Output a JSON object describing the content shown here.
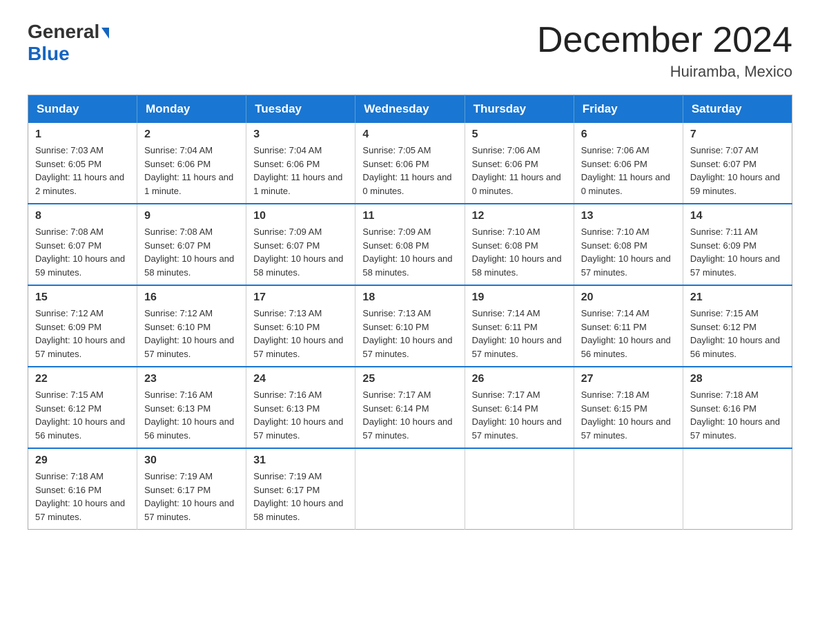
{
  "header": {
    "logo_general": "General",
    "logo_blue": "Blue",
    "month_title": "December 2024",
    "location": "Huiramba, Mexico"
  },
  "weekdays": [
    "Sunday",
    "Monday",
    "Tuesday",
    "Wednesday",
    "Thursday",
    "Friday",
    "Saturday"
  ],
  "weeks": [
    [
      {
        "day": "1",
        "sunrise": "7:03 AM",
        "sunset": "6:05 PM",
        "daylight": "11 hours and 2 minutes."
      },
      {
        "day": "2",
        "sunrise": "7:04 AM",
        "sunset": "6:06 PM",
        "daylight": "11 hours and 1 minute."
      },
      {
        "day": "3",
        "sunrise": "7:04 AM",
        "sunset": "6:06 PM",
        "daylight": "11 hours and 1 minute."
      },
      {
        "day": "4",
        "sunrise": "7:05 AM",
        "sunset": "6:06 PM",
        "daylight": "11 hours and 0 minutes."
      },
      {
        "day": "5",
        "sunrise": "7:06 AM",
        "sunset": "6:06 PM",
        "daylight": "11 hours and 0 minutes."
      },
      {
        "day": "6",
        "sunrise": "7:06 AM",
        "sunset": "6:06 PM",
        "daylight": "11 hours and 0 minutes."
      },
      {
        "day": "7",
        "sunrise": "7:07 AM",
        "sunset": "6:07 PM",
        "daylight": "10 hours and 59 minutes."
      }
    ],
    [
      {
        "day": "8",
        "sunrise": "7:08 AM",
        "sunset": "6:07 PM",
        "daylight": "10 hours and 59 minutes."
      },
      {
        "day": "9",
        "sunrise": "7:08 AM",
        "sunset": "6:07 PM",
        "daylight": "10 hours and 58 minutes."
      },
      {
        "day": "10",
        "sunrise": "7:09 AM",
        "sunset": "6:07 PM",
        "daylight": "10 hours and 58 minutes."
      },
      {
        "day": "11",
        "sunrise": "7:09 AM",
        "sunset": "6:08 PM",
        "daylight": "10 hours and 58 minutes."
      },
      {
        "day": "12",
        "sunrise": "7:10 AM",
        "sunset": "6:08 PM",
        "daylight": "10 hours and 58 minutes."
      },
      {
        "day": "13",
        "sunrise": "7:10 AM",
        "sunset": "6:08 PM",
        "daylight": "10 hours and 57 minutes."
      },
      {
        "day": "14",
        "sunrise": "7:11 AM",
        "sunset": "6:09 PM",
        "daylight": "10 hours and 57 minutes."
      }
    ],
    [
      {
        "day": "15",
        "sunrise": "7:12 AM",
        "sunset": "6:09 PM",
        "daylight": "10 hours and 57 minutes."
      },
      {
        "day": "16",
        "sunrise": "7:12 AM",
        "sunset": "6:10 PM",
        "daylight": "10 hours and 57 minutes."
      },
      {
        "day": "17",
        "sunrise": "7:13 AM",
        "sunset": "6:10 PM",
        "daylight": "10 hours and 57 minutes."
      },
      {
        "day": "18",
        "sunrise": "7:13 AM",
        "sunset": "6:10 PM",
        "daylight": "10 hours and 57 minutes."
      },
      {
        "day": "19",
        "sunrise": "7:14 AM",
        "sunset": "6:11 PM",
        "daylight": "10 hours and 57 minutes."
      },
      {
        "day": "20",
        "sunrise": "7:14 AM",
        "sunset": "6:11 PM",
        "daylight": "10 hours and 56 minutes."
      },
      {
        "day": "21",
        "sunrise": "7:15 AM",
        "sunset": "6:12 PM",
        "daylight": "10 hours and 56 minutes."
      }
    ],
    [
      {
        "day": "22",
        "sunrise": "7:15 AM",
        "sunset": "6:12 PM",
        "daylight": "10 hours and 56 minutes."
      },
      {
        "day": "23",
        "sunrise": "7:16 AM",
        "sunset": "6:13 PM",
        "daylight": "10 hours and 56 minutes."
      },
      {
        "day": "24",
        "sunrise": "7:16 AM",
        "sunset": "6:13 PM",
        "daylight": "10 hours and 57 minutes."
      },
      {
        "day": "25",
        "sunrise": "7:17 AM",
        "sunset": "6:14 PM",
        "daylight": "10 hours and 57 minutes."
      },
      {
        "day": "26",
        "sunrise": "7:17 AM",
        "sunset": "6:14 PM",
        "daylight": "10 hours and 57 minutes."
      },
      {
        "day": "27",
        "sunrise": "7:18 AM",
        "sunset": "6:15 PM",
        "daylight": "10 hours and 57 minutes."
      },
      {
        "day": "28",
        "sunrise": "7:18 AM",
        "sunset": "6:16 PM",
        "daylight": "10 hours and 57 minutes."
      }
    ],
    [
      {
        "day": "29",
        "sunrise": "7:18 AM",
        "sunset": "6:16 PM",
        "daylight": "10 hours and 57 minutes."
      },
      {
        "day": "30",
        "sunrise": "7:19 AM",
        "sunset": "6:17 PM",
        "daylight": "10 hours and 57 minutes."
      },
      {
        "day": "31",
        "sunrise": "7:19 AM",
        "sunset": "6:17 PM",
        "daylight": "10 hours and 58 minutes."
      },
      null,
      null,
      null,
      null
    ]
  ]
}
